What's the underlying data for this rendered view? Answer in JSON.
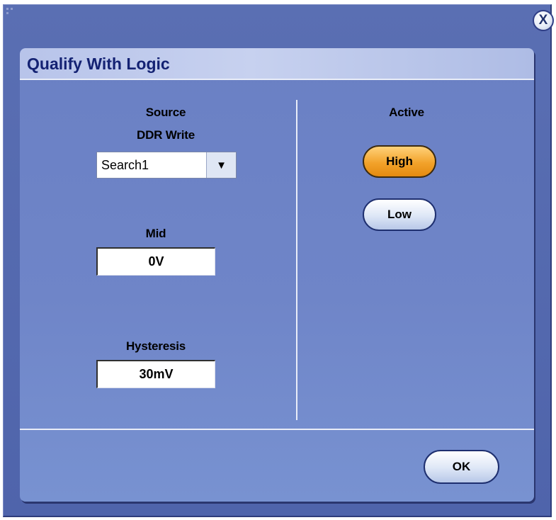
{
  "close_button": {
    "label": "X"
  },
  "dialog": {
    "title": "Qualify With Logic",
    "source": {
      "heading": "Source",
      "subheading": "DDR Write",
      "selected": "Search1"
    },
    "mid": {
      "label": "Mid",
      "value": "0V"
    },
    "hysteresis": {
      "label": "Hysteresis",
      "value": "30mV"
    },
    "active": {
      "label": "Active",
      "options": [
        "High",
        "Low"
      ],
      "selected": "High"
    },
    "ok_label": "OK"
  },
  "colors": {
    "window_bg": "#5a6fb3",
    "dialog_bg": "#6f85c8",
    "title_bar": "#c7d1ef",
    "title_text": "#142273",
    "selected_option": "#f2a22a",
    "unselected_option": "#dde6f6"
  },
  "icons": {
    "close": "close-icon",
    "dropdown": "chevron-down-icon",
    "window_corner": "resize-grip-icon"
  }
}
